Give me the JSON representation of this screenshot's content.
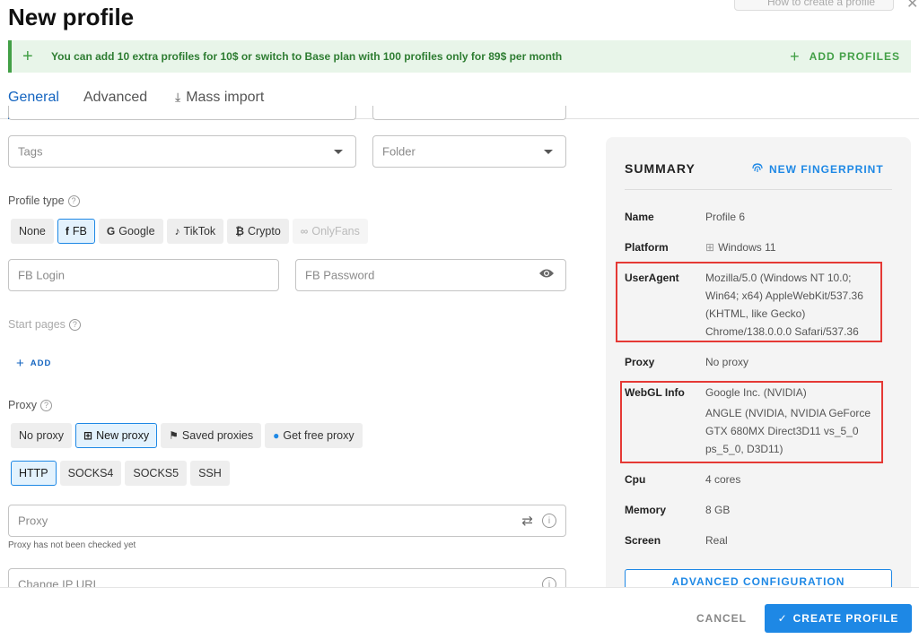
{
  "page": {
    "title": "New profile",
    "howto_label": "How to create a profile"
  },
  "banner": {
    "message": "You can add 10 extra profiles for 10$ or switch to Base plan with 100 profiles only for 89$ per month",
    "action_label": "ADD PROFILES"
  },
  "tabs": [
    {
      "label": "General"
    },
    {
      "label": "Advanced"
    },
    {
      "label": "Mass import"
    }
  ],
  "form": {
    "tags_placeholder": "Tags",
    "folder_placeholder": "Folder",
    "profile_type_label": "Profile type",
    "profile_types": [
      {
        "label": "None"
      },
      {
        "label": "FB"
      },
      {
        "label": "Google"
      },
      {
        "label": "TikTok"
      },
      {
        "label": "Crypto"
      },
      {
        "label": "OnlyFans"
      }
    ],
    "selected_profile_type": "FB",
    "fb_login_placeholder": "FB Login",
    "fb_password_placeholder": "FB Password",
    "start_pages_label": "Start pages",
    "add_label": "ADD",
    "proxy_label": "Proxy",
    "proxy_modes": [
      {
        "label": "No proxy"
      },
      {
        "label": "New proxy"
      },
      {
        "label": "Saved proxies"
      },
      {
        "label": "Get free proxy"
      }
    ],
    "selected_proxy_mode": "New proxy",
    "protocols": [
      {
        "label": "HTTP"
      },
      {
        "label": "SOCKS4"
      },
      {
        "label": "SOCKS5"
      },
      {
        "label": "SSH"
      }
    ],
    "selected_protocol": "HTTP",
    "proxy_placeholder": "Proxy",
    "proxy_hint": "Proxy has not been checked yet",
    "change_ip_placeholder": "Change IP URL"
  },
  "summary": {
    "heading": "SUMMARY",
    "new_fingerprint_label": "NEW FINGERPRINT",
    "rows": {
      "name": {
        "key": "Name",
        "value": "Profile 6"
      },
      "platform": {
        "key": "Platform",
        "value": "Windows 11"
      },
      "useragent": {
        "key": "UserAgent",
        "value": "Mozilla/5.0 (Windows NT 10.0; Win64; x64) AppleWebKit/537.36 (KHTML, like Gecko) Chrome/138.0.0.0 Safari/537.36"
      },
      "proxy": {
        "key": "Proxy",
        "value": "No proxy"
      },
      "webgl": {
        "key": "WebGL Info",
        "vendor": "Google Inc. (NVIDIA)",
        "renderer": "ANGLE (NVIDIA, NVIDIA GeForce GTX 680MX Direct3D11 vs_5_0 ps_5_0, D3D11)"
      },
      "cpu": {
        "key": "Cpu",
        "value": "4 cores"
      },
      "memory": {
        "key": "Memory",
        "value": "8 GB"
      },
      "screen": {
        "key": "Screen",
        "value": "Real"
      }
    },
    "advanced_config_label": "ADVANCED CONFIGURATION"
  },
  "footer": {
    "cancel_label": "CANCEL",
    "create_label": "CREATE PROFILE"
  },
  "colors": {
    "accent": "#1e88e5",
    "banner_bg": "#e8f5e9",
    "banner_text": "#2e7d32",
    "highlight_red": "#e53935"
  }
}
